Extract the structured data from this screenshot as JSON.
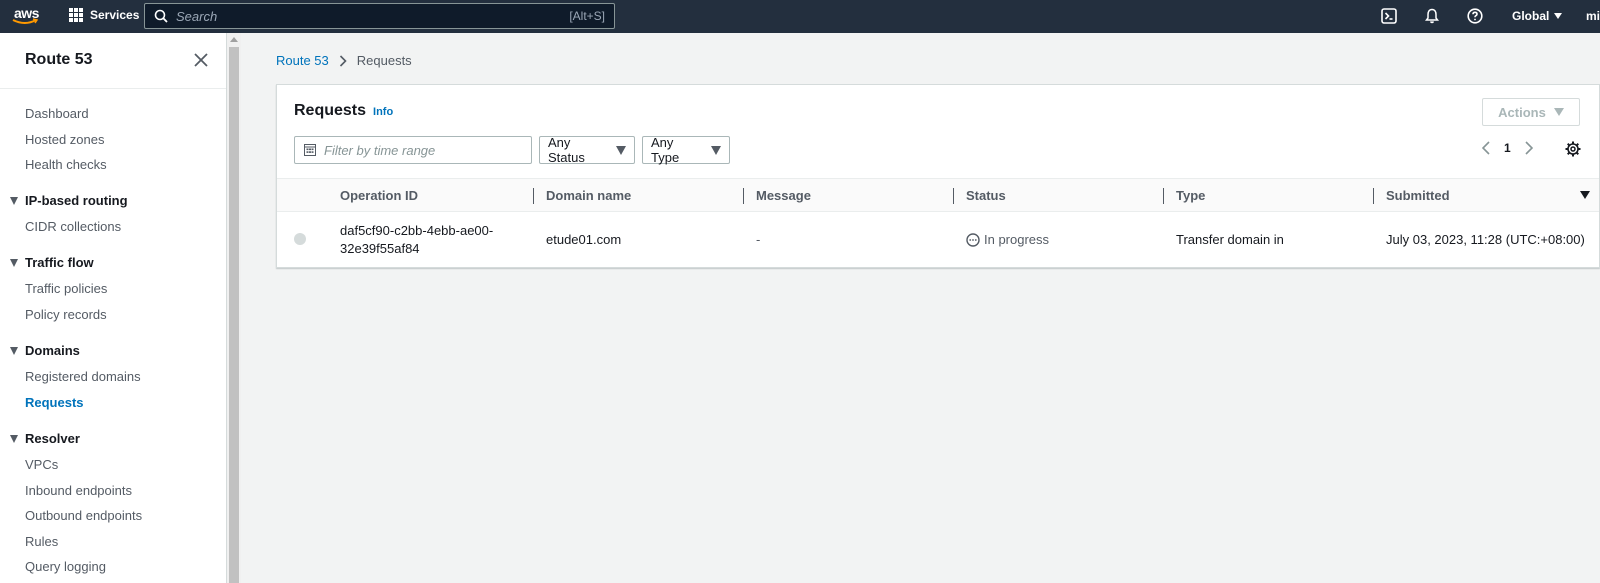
{
  "topnav": {
    "logo_text": "aws",
    "services_label": "Services",
    "search_placeholder": "Search",
    "search_shortcut": "[Alt+S]",
    "region_label": "Global",
    "user_label": "mi"
  },
  "sidebar": {
    "title": "Route 53",
    "items_top": [
      "Dashboard",
      "Hosted zones",
      "Health checks"
    ],
    "sections": [
      {
        "label": "IP-based routing",
        "items": [
          "CIDR collections"
        ]
      },
      {
        "label": "Traffic flow",
        "items": [
          "Traffic policies",
          "Policy records"
        ]
      },
      {
        "label": "Domains",
        "items": [
          "Registered domains",
          "Requests"
        ]
      },
      {
        "label": "Resolver",
        "items": [
          "VPCs",
          "Inbound endpoints",
          "Outbound endpoints",
          "Rules",
          "Query logging"
        ]
      }
    ],
    "active_item": "Requests"
  },
  "breadcrumb": {
    "root": "Route 53",
    "current": "Requests"
  },
  "panel": {
    "title": "Requests",
    "info_label": "Info",
    "actions_label": "Actions",
    "filter_placeholder": "Filter by time range",
    "status_filter": "Any Status",
    "type_filter": "Any Type",
    "page_number": "1"
  },
  "table": {
    "columns": [
      "Operation ID",
      "Domain name",
      "Message",
      "Status",
      "Type",
      "Submitted"
    ],
    "rows": [
      {
        "operation_id_line1": "daf5cf90-c2bb-4ebb-ae00-",
        "operation_id_line2": "32e39f55af84",
        "domain": "etude01.com",
        "message": "-",
        "status": "In progress",
        "type": "Transfer domain in",
        "submitted": "July 03, 2023, 11:28 (UTC:+08:00)"
      }
    ]
  },
  "colors": {
    "nav_bg": "#232f3e",
    "link": "#0073bb",
    "page_bg": "#f2f3f3",
    "aws_orange": "#ff9900"
  }
}
